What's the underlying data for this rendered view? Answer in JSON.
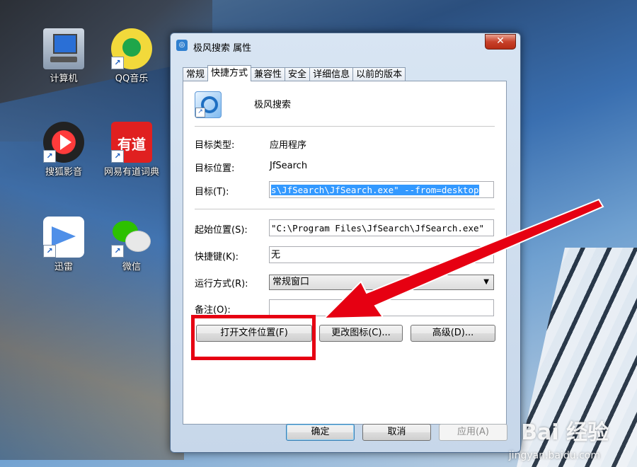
{
  "desktop": {
    "icons": [
      {
        "label": "计算机",
        "icon": "computer-icon"
      },
      {
        "label": "QQ音乐",
        "icon": "qq-music-icon"
      },
      {
        "label": "搜狐影音",
        "icon": "sohu-video-icon"
      },
      {
        "label": "网易有道词典",
        "icon": "youdao-dict-icon",
        "glyph_text": "有道"
      },
      {
        "label": "迅雷",
        "icon": "thunder-icon"
      },
      {
        "label": "微信",
        "icon": "wechat-icon"
      }
    ]
  },
  "dialog": {
    "title": "极风搜索 属性",
    "close_label": "✕",
    "tabs": [
      "常规",
      "快捷方式",
      "兼容性",
      "安全",
      "详细信息",
      "以前的版本"
    ],
    "active_tab": "快捷方式",
    "app_name": "极风搜索",
    "target_type_label": "目标类型:",
    "target_type_value": "应用程序",
    "target_location_label": "目标位置:",
    "target_location_value": "JfSearch",
    "target_label": "目标(T):",
    "target_value": "s\\JfSearch\\JfSearch.exe\" --from=desktop",
    "start_in_label": "起始位置(S):",
    "start_in_value": "\"C:\\Program Files\\JfSearch\\JfSearch.exe\"",
    "shortcut_key_label": "快捷键(K):",
    "shortcut_key_value": "无",
    "run_label": "运行方式(R):",
    "run_value": "常规窗口",
    "comment_label": "备注(O):",
    "comment_value": "",
    "open_location_button": "打开文件位置(F)",
    "change_icon_button": "更改图标(C)...",
    "advanced_button": "高级(D)...",
    "ok_button": "确定",
    "cancel_button": "取消",
    "apply_button": "应用(A)"
  },
  "annotation": {
    "highlight_color": "#e60012"
  },
  "watermark": {
    "brand": "Bai 经验",
    "url": "jingyan.baidu.com"
  }
}
